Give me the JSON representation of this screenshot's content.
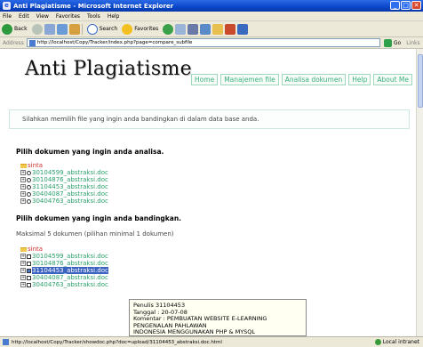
{
  "window": {
    "title": "Anti Plagiatisme - Microsoft Internet Explorer",
    "buttons": [
      "_",
      "□",
      "✕"
    ]
  },
  "menu": [
    "File",
    "Edit",
    "View",
    "Favorites",
    "Tools",
    "Help"
  ],
  "toolbar": {
    "back": "Back",
    "search": "Search",
    "favorites": "Favorites"
  },
  "address": {
    "label": "Address",
    "url": "http://localhost/Copy/Tracker/index.php?page=compare_subfile",
    "go": "Go",
    "links": "Links"
  },
  "site": {
    "logo": "Anti Plagiatisme",
    "nav": [
      "Home",
      "Manajemen file",
      "Analisa dokumen",
      "Help",
      "About Me"
    ],
    "info": "Silahkan memilih file yang ingin anda bandingkan di dalam data base anda."
  },
  "section1": {
    "title": "Pilih dokumen yang ingin anda analisa.",
    "root": "sinta",
    "files": [
      "30104599_abstraksi.doc",
      "30104876_abstraksi.doc",
      "31104453_abstraksi.doc",
      "30404087_abstraksi.doc",
      "30404763_abstraksi.doc"
    ]
  },
  "section2": {
    "title": "Pilih dokumen yang ingin anda bandingkan.",
    "note": "Maksimal 5 dokumen (pilihan minimal 1 dokumen)",
    "root": "sinta",
    "files": [
      "30104599_abstraksi.doc",
      "30104876_abstraksi.doc",
      "31104453_abstraksi.doc",
      "30404087_abstraksi.doc",
      "30404763_abstraksi.doc"
    ]
  },
  "tooltip": {
    "line1": "Penulis 31104453",
    "line2": "Tanggal : 20-07-08",
    "line3": "Komentar : PEMBUATAN WEBSITE E-LEARNING PENGENALAN PAHLAWAN",
    "line4": "INDONESIA MENGGUNAKAN PHP & MYSQL"
  },
  "status": {
    "url": "http://localhost/Copy/Tracker/showdoc.php?doc=upload/31104453_abstraksi.doc.html",
    "zone": "Local intranet"
  },
  "colors": {
    "link": "#2aa06a",
    "root": "#d03030",
    "highlight": "#3a62c0"
  }
}
